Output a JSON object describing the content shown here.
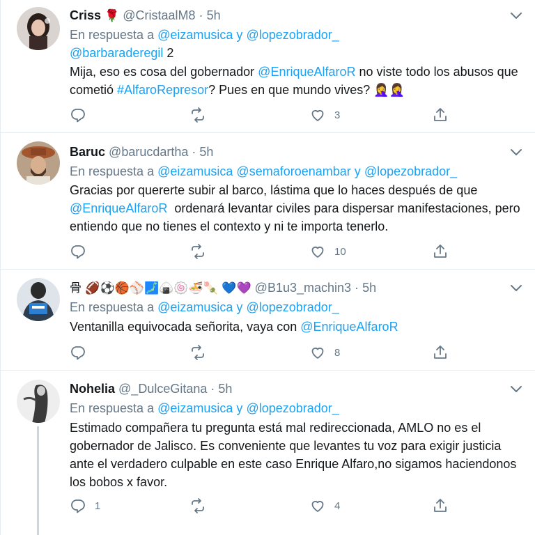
{
  "tweets": [
    {
      "name": "Criss",
      "name_emoji": "🌹",
      "handle": "@CristaalM8",
      "sep": "·",
      "time": "5h",
      "reply_prefix": "En respuesta a",
      "reply_line1_mentions": [
        "@eizamusica",
        "y",
        "@lopezobrador_"
      ],
      "reply_line2_mention": "@barbaraderegil",
      "reply_line2_count": "2",
      "body_parts": [
        "Mija, eso es cosa del gobernador ",
        "@EnriqueAlfaroR",
        " no viste todo los abusos que cometió ",
        "#AlfaroRepresor",
        "? Pues en que mundo vives? 🤦‍♀️🤦‍♀️"
      ],
      "reply_count": "",
      "retweet_count": "",
      "like_count": "3"
    },
    {
      "name": "Baruc",
      "handle": "@barucdartha",
      "sep": "·",
      "time": "5h",
      "reply_prefix": "En respuesta a",
      "reply_mentions": [
        "@eizamusica",
        "@semaforoenambar",
        "y",
        "@lopezobrador_"
      ],
      "body_parts": [
        "Gracias por quererte subir al barco, lástima que lo haces después de que ",
        "@EnriqueAlfaroR",
        "  ordenará levantar civiles para dispersar manifestaciones, pero entiendo que no tienes el contexto y ni te importa tenerlo."
      ],
      "reply_count": "",
      "retweet_count": "",
      "like_count": "10"
    },
    {
      "name": "骨 🏈⚽🏀⚾🗾🍙🍥🍜🍡 💙💜",
      "handle": "@B1u3_machin3",
      "sep": "·",
      "time": "5h",
      "reply_prefix": "En respuesta a",
      "reply_mentions": [
        "@eizamusica",
        "y",
        "@lopezobrador_"
      ],
      "body_parts": [
        "Ventanilla equivocada señorita, vaya con ",
        "@EnriqueAlfaroR"
      ],
      "reply_count": "",
      "retweet_count": "",
      "like_count": "8"
    },
    {
      "name": "Nohelia",
      "handle": "@_DulceGitana",
      "sep": "·",
      "time": "5h",
      "reply_prefix": "En respuesta a",
      "reply_mentions": [
        "@eizamusica",
        "y",
        "@lopezobrador_"
      ],
      "body": "Estimado compañera tu pregunta está mal redireccionada, AMLO no es el gobernador de Jalisco. Es conveniente que levantes tu voz para exigir justicia ante el verdadero culpable en este caso Enrique Alfaro,no sigamos haciendonos los bobos x favor.",
      "reply_count": "1",
      "retweet_count": "",
      "like_count": "4"
    }
  ],
  "colors": {
    "link": "#1da1f2",
    "muted": "#657786",
    "text": "#14171a",
    "border": "#e6ecf0"
  },
  "icons": [
    "chevron-down-icon",
    "reply-icon",
    "retweet-icon",
    "heart-icon",
    "share-icon"
  ]
}
